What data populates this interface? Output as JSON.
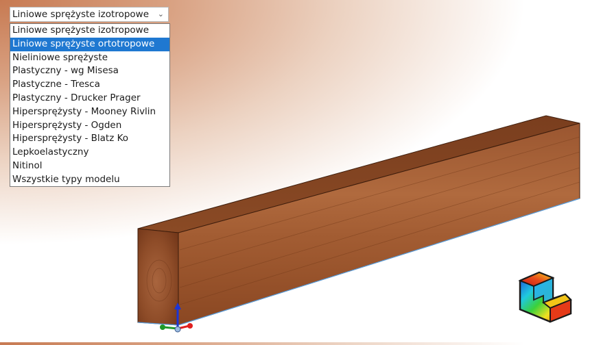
{
  "material_model": {
    "selected_value": "Liniowe sprężyste izotropowe",
    "options": [
      "Liniowe sprężyste izotropowe",
      "Liniowe sprężyste ortotropowe",
      "Nieliniowe sprężyste",
      "Plastyczny - wg Misesa",
      "Plastyczne - Tresca",
      "Plastyczny - Drucker Prager",
      "Hipersprężysty - Mooney Rivlin",
      "Hipersprężysty - Ogden",
      "Hipersprężysty - Blatz Ko",
      "Lepkoelastyczny",
      "Nitinol",
      "Wszystkie typy modelu"
    ],
    "highlighted_index": 1
  },
  "viewport": {
    "model": "wooden-beam",
    "accent_color": "#1f78d1"
  }
}
